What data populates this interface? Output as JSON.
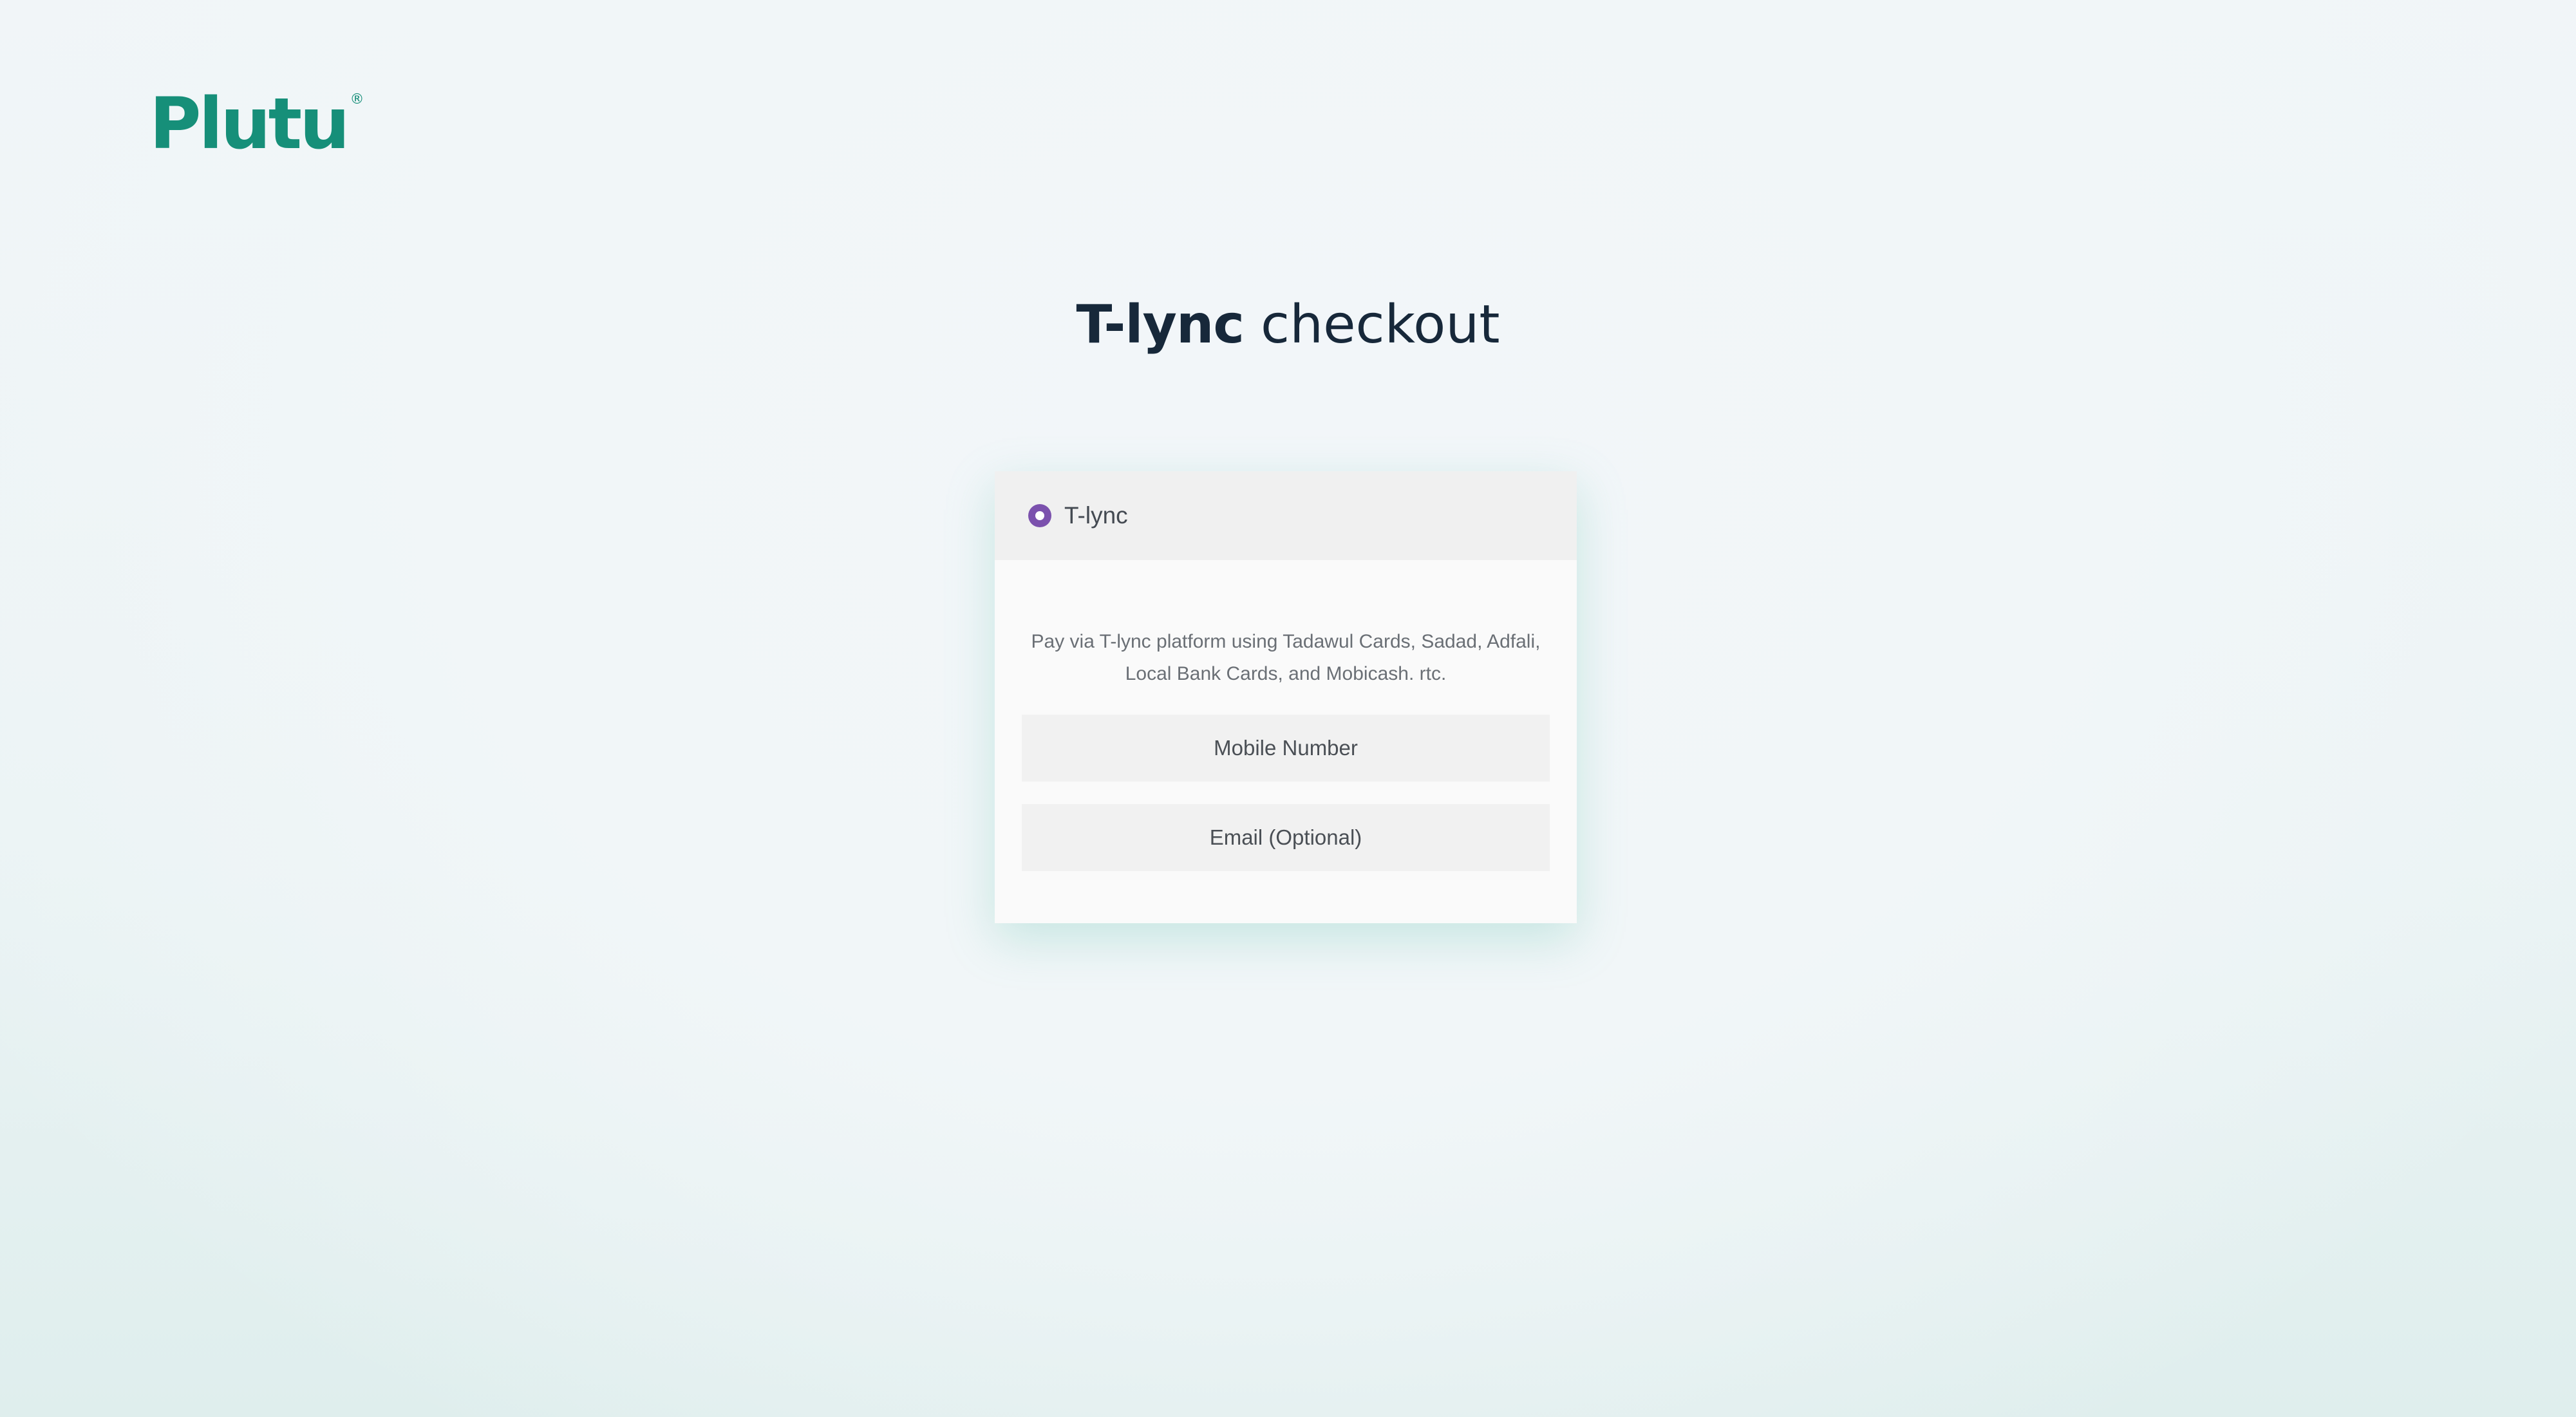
{
  "brand": {
    "logo_text": "Plutu",
    "logo_mark": "®"
  },
  "page": {
    "title_bold": "T-lync",
    "title_rest": " checkout"
  },
  "payment_method": {
    "label": "T-lync",
    "selected": true,
    "description": "Pay via T-lync platform using Tadawul Cards, Sadad, Adfali, Local Bank Cards, and Mobicash. rtc.",
    "mobile_placeholder": "Mobile Number",
    "mobile_value": "",
    "email_placeholder": "Email (Optional)",
    "email_value": ""
  },
  "colors": {
    "brand_green": "#168f79",
    "radio_purple": "#7b51ad",
    "title_navy": "#17283a"
  }
}
